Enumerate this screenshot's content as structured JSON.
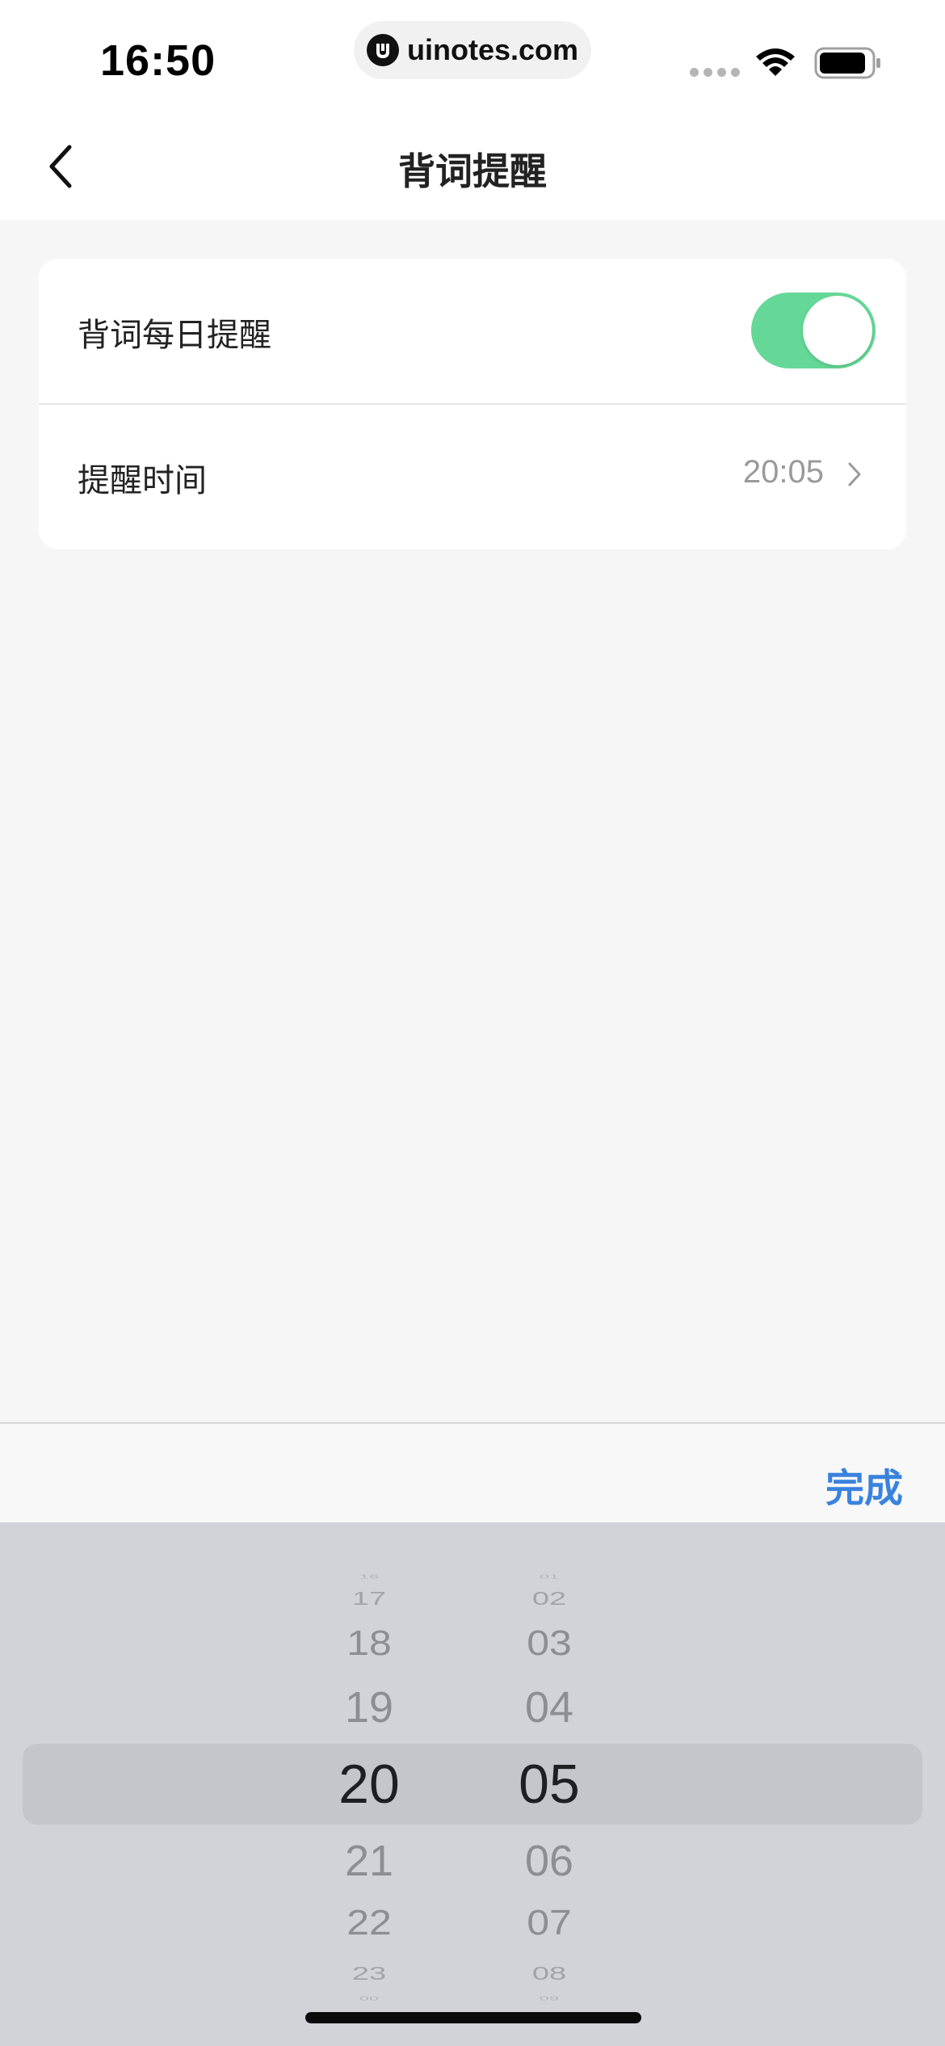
{
  "status_bar": {
    "time": "16:50",
    "url": "uinotes.com"
  },
  "nav": {
    "title": "背词提醒"
  },
  "settings": {
    "daily_reminder_label": "背词每日提醒",
    "daily_reminder_enabled": true,
    "reminder_time_label": "提醒时间",
    "reminder_time_value": "20:05"
  },
  "picker": {
    "done_label": "完成",
    "hours": {
      "m4": "16",
      "m3": "17",
      "m2": "18",
      "m1": "19",
      "selected": "20",
      "p1": "21",
      "p2": "22",
      "p3": "23",
      "p4": "00"
    },
    "minutes": {
      "m4": "01",
      "m3": "02",
      "m2": "03",
      "m1": "04",
      "selected": "05",
      "p1": "06",
      "p2": "07",
      "p3": "08",
      "p4": "09"
    }
  },
  "colors": {
    "toggle_on": "#65d897",
    "accent": "#3a82dd",
    "background": "#f6f6f6",
    "picker_background": "#d1d3d9"
  },
  "icons": {
    "back": "chevron-left-icon",
    "row_arrow": "chevron-right-icon",
    "wifi": "wifi-icon",
    "battery": "battery-icon",
    "signal": "signal-icon"
  }
}
